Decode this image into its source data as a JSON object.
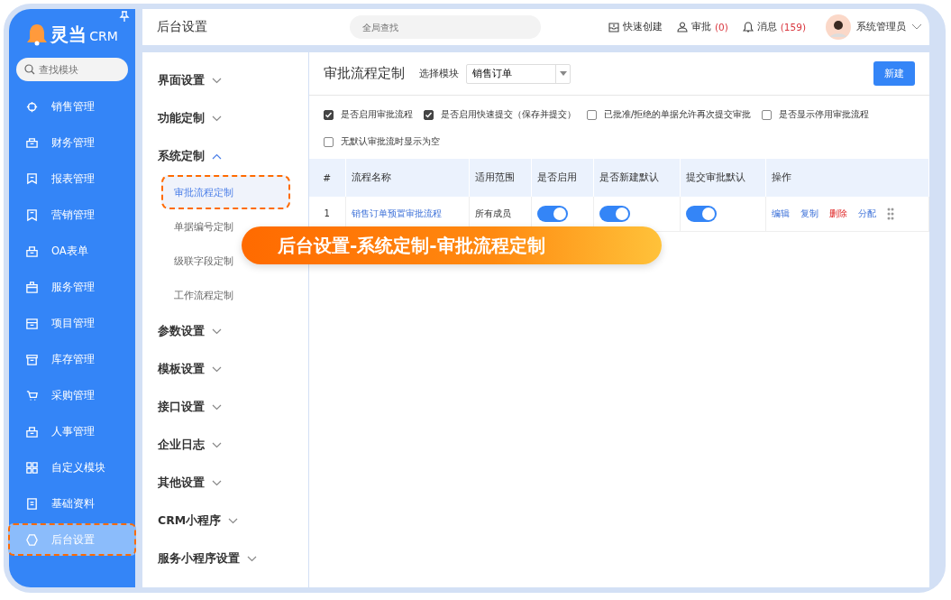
{
  "logo": {
    "name": "灵当",
    "suffix": "CRM"
  },
  "sidebar": {
    "search_placeholder": "查找模块",
    "items": [
      {
        "label": "销售管理",
        "selected": false,
        "highlighted": false
      },
      {
        "label": "财务管理",
        "selected": false,
        "highlighted": false
      },
      {
        "label": "报表管理",
        "selected": false,
        "highlighted": false
      },
      {
        "label": "营销管理",
        "selected": false,
        "highlighted": false
      },
      {
        "label": "OA表单",
        "selected": false,
        "highlighted": false
      },
      {
        "label": "服务管理",
        "selected": false,
        "highlighted": false
      },
      {
        "label": "项目管理",
        "selected": false,
        "highlighted": false
      },
      {
        "label": "库存管理",
        "selected": false,
        "highlighted": false
      },
      {
        "label": "采购管理",
        "selected": false,
        "highlighted": false
      },
      {
        "label": "人事管理",
        "selected": false,
        "highlighted": false
      },
      {
        "label": "自定义模块",
        "selected": false,
        "highlighted": false
      },
      {
        "label": "基础资料",
        "selected": false,
        "highlighted": false
      },
      {
        "label": "后台设置",
        "selected": true,
        "highlighted": true
      }
    ]
  },
  "topbar": {
    "title": "后台设置",
    "search_placeholder": "全局查找",
    "actions": [
      {
        "label": "快速创建"
      },
      {
        "label": "审批",
        "count": "(0)"
      },
      {
        "label": "消息",
        "count": "(159)"
      }
    ],
    "user": "系统管理员"
  },
  "settings_menu": [
    {
      "label": "界面设置",
      "expanded": false
    },
    {
      "label": "功能定制",
      "expanded": false
    },
    {
      "label": "系统定制",
      "expanded": true,
      "children": [
        {
          "label": "审批流程定制",
          "selected": true,
          "highlighted": true
        },
        {
          "label": "单据编号定制",
          "selected": false,
          "highlighted": false
        },
        {
          "label": "级联字段定制",
          "selected": false,
          "highlighted": false
        },
        {
          "label": "工作流程定制",
          "selected": false,
          "highlighted": false
        }
      ]
    },
    {
      "label": "参数设置",
      "expanded": false
    },
    {
      "label": "模板设置",
      "expanded": false
    },
    {
      "label": "接口设置",
      "expanded": false
    },
    {
      "label": "企业日志",
      "expanded": false
    },
    {
      "label": "其他设置",
      "expanded": false
    },
    {
      "label": "CRM小程序",
      "expanded": false
    },
    {
      "label": "服务小程序设置",
      "expanded": false
    }
  ],
  "panel": {
    "title": "审批流程定制",
    "module_label": "选择模块",
    "module_value": "销售订单",
    "new_button": "新建",
    "options": [
      {
        "label": "是否启用审批流程",
        "checked": true
      },
      {
        "label": "是否启用快速提交（保存并提交）",
        "checked": true
      },
      {
        "label": "已批准/拒绝的单据允许再次提交审批",
        "checked": false
      },
      {
        "label": "是否显示停用审批流程",
        "checked": false
      },
      {
        "label": "无默认审批流时显示为空",
        "checked": false
      }
    ],
    "table": {
      "columns": [
        "#",
        "流程名称",
        "适用范围",
        "是否启用",
        "是否新建默认",
        "提交审批默认",
        "操作"
      ],
      "rows": [
        {
          "index": "1",
          "name": "销售订单预置审批流程",
          "scope": "所有成员",
          "enabled": true,
          "default_new": true,
          "default_submit": true,
          "actions": [
            {
              "label": "编辑",
              "kind": "normal"
            },
            {
              "label": "复制",
              "kind": "normal"
            },
            {
              "label": "删除",
              "kind": "danger"
            },
            {
              "label": "分配",
              "kind": "normal"
            }
          ]
        }
      ]
    }
  },
  "banner": "后台设置-系统定制-审批流程定制"
}
